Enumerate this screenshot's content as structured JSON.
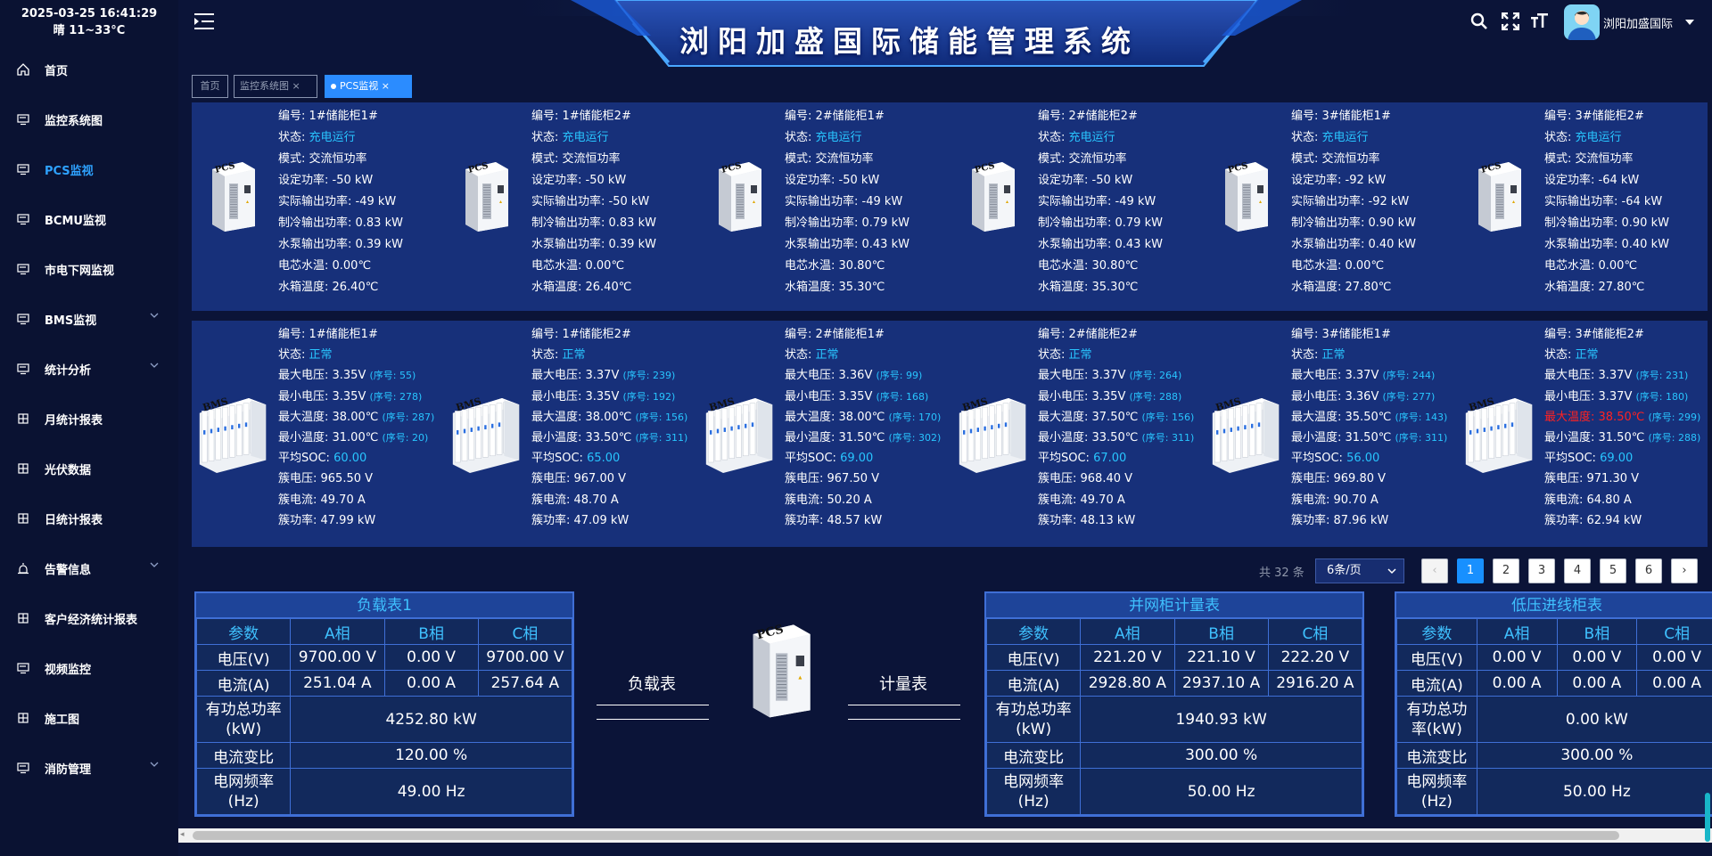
{
  "header": {
    "datetime": "2025-03-25 16:41:29",
    "weather": "晴 11~33°C",
    "title": "浏阳加盛国际储能管理系统",
    "user": "浏阳加盛国际"
  },
  "sidebar": {
    "items": [
      {
        "label": "首页",
        "icon": "home-icon"
      },
      {
        "label": "监控系统图",
        "icon": "monitor-icon"
      },
      {
        "label": "PCS监视",
        "icon": "monitor-icon",
        "active": true
      },
      {
        "label": "BCMU监视",
        "icon": "monitor-icon"
      },
      {
        "label": "市电下网监视",
        "icon": "monitor-icon"
      },
      {
        "label": "BMS监视",
        "icon": "monitor-icon",
        "expandable": true
      },
      {
        "label": "统计分析",
        "icon": "monitor-icon",
        "expandable": true
      },
      {
        "label": "月统计报表",
        "icon": "grid-icon"
      },
      {
        "label": "光伏数据",
        "icon": "grid-icon"
      },
      {
        "label": "日统计报表",
        "icon": "grid-icon"
      },
      {
        "label": "告警信息",
        "icon": "alarm-icon",
        "expandable": true
      },
      {
        "label": "客户经济统计报表",
        "icon": "grid-icon"
      },
      {
        "label": "视频监控",
        "icon": "monitor-icon"
      },
      {
        "label": "施工图",
        "icon": "grid-icon"
      },
      {
        "label": "消防管理",
        "icon": "monitor-icon",
        "expandable": true
      }
    ]
  },
  "tabs": [
    {
      "label": "首页"
    },
    {
      "label": "监控系统图",
      "close": "×"
    },
    {
      "label": "PCS监视",
      "close": "×",
      "active": true
    }
  ],
  "pcs": [
    {
      "id": "编号: 1#储能柜1#",
      "status_label": "状态: ",
      "status": "充电运行",
      "mode": "模式: 交流恒功率",
      "set_power": "设定功率: -50 kW",
      "actual_power": "实际输出功率: -49 kW",
      "cool_power": "制冷输出功率: 0.83 kW",
      "pump_power": "水泵输出功率: 0.39 kW",
      "cell_temp": "电芯水温: 0.00℃",
      "tank_temp": "水箱温度: 26.40℃"
    },
    {
      "id": "编号: 1#储能柜2#",
      "status_label": "状态: ",
      "status": "充电运行",
      "mode": "模式: 交流恒功率",
      "set_power": "设定功率: -50 kW",
      "actual_power": "实际输出功率: -50 kW",
      "cool_power": "制冷输出功率: 0.83 kW",
      "pump_power": "水泵输出功率: 0.39 kW",
      "cell_temp": "电芯水温: 0.00℃",
      "tank_temp": "水箱温度: 26.40℃"
    },
    {
      "id": "编号: 2#储能柜1#",
      "status_label": "状态: ",
      "status": "充电运行",
      "mode": "模式: 交流恒功率",
      "set_power": "设定功率: -50 kW",
      "actual_power": "实际输出功率: -49 kW",
      "cool_power": "制冷输出功率: 0.79 kW",
      "pump_power": "水泵输出功率: 0.43 kW",
      "cell_temp": "电芯水温: 30.80℃",
      "tank_temp": "水箱温度: 35.30℃"
    },
    {
      "id": "编号: 2#储能柜2#",
      "status_label": "状态: ",
      "status": "充电运行",
      "mode": "模式: 交流恒功率",
      "set_power": "设定功率: -50 kW",
      "actual_power": "实际输出功率: -49 kW",
      "cool_power": "制冷输出功率: 0.79 kW",
      "pump_power": "水泵输出功率: 0.43 kW",
      "cell_temp": "电芯水温: 30.80℃",
      "tank_temp": "水箱温度: 35.30℃"
    },
    {
      "id": "编号: 3#储能柜1#",
      "status_label": "状态: ",
      "status": "充电运行",
      "mode": "模式: 交流恒功率",
      "set_power": "设定功率: -92 kW",
      "actual_power": "实际输出功率: -92 kW",
      "cool_power": "制冷输出功率: 0.90 kW",
      "pump_power": "水泵输出功率: 0.40 kW",
      "cell_temp": "电芯水温: 0.00℃",
      "tank_temp": "水箱温度: 27.80℃"
    },
    {
      "id": "编号: 3#储能柜2#",
      "status_label": "状态: ",
      "status": "充电运行",
      "mode": "模式: 交流恒功率",
      "set_power": "设定功率: -64 kW",
      "actual_power": "实际输出功率: -64 kW",
      "cool_power": "制冷输出功率: 0.90 kW",
      "pump_power": "水泵输出功率: 0.40 kW",
      "cell_temp": "电芯水温: 0.00℃",
      "tank_temp": "水箱温度: 27.80℃"
    }
  ],
  "bms": [
    {
      "id": "编号: 1#储能柜1#",
      "status_label": "状态: ",
      "status": "正常",
      "max_v": "最大电压: 3.35V",
      "max_v_seq": "(序号: 55)",
      "min_v": "最小电压: 3.35V",
      "min_v_seq": "(序号: 278)",
      "max_t_label": "最大温度: ",
      "max_t": "38.00℃",
      "max_t_seq": "(序号: 287)",
      "min_t": "最小温度: 31.00℃",
      "min_t_seq": "(序号: 20)",
      "soc_label": "平均SOC: ",
      "soc": "60.00",
      "cluster_v": "簇电压: 965.50 V",
      "cluster_i": "簇电流: 49.70 A",
      "cluster_p": "簇功率: 47.99 kW",
      "alarm": false
    },
    {
      "id": "编号: 1#储能柜2#",
      "status_label": "状态: ",
      "status": "正常",
      "max_v": "最大电压: 3.37V",
      "max_v_seq": "(序号: 239)",
      "min_v": "最小电压: 3.35V",
      "min_v_seq": "(序号: 192)",
      "max_t_label": "最大温度: ",
      "max_t": "38.00℃",
      "max_t_seq": "(序号: 156)",
      "min_t": "最小温度: 33.50℃",
      "min_t_seq": "(序号: 311)",
      "soc_label": "平均SOC: ",
      "soc": "65.00",
      "cluster_v": "簇电压: 967.00 V",
      "cluster_i": "簇电流: 48.70 A",
      "cluster_p": "簇功率: 47.09 kW",
      "alarm": false
    },
    {
      "id": "编号: 2#储能柜1#",
      "status_label": "状态: ",
      "status": "正常",
      "max_v": "最大电压: 3.36V",
      "max_v_seq": "(序号: 99)",
      "min_v": "最小电压: 3.35V",
      "min_v_seq": "(序号: 168)",
      "max_t_label": "最大温度: ",
      "max_t": "38.00℃",
      "max_t_seq": "(序号: 170)",
      "min_t": "最小温度: 31.50℃",
      "min_t_seq": "(序号: 302)",
      "soc_label": "平均SOC: ",
      "soc": "69.00",
      "cluster_v": "簇电压: 967.50 V",
      "cluster_i": "簇电流: 50.20 A",
      "cluster_p": "簇功率: 48.57 kW",
      "alarm": false
    },
    {
      "id": "编号: 2#储能柜2#",
      "status_label": "状态: ",
      "status": "正常",
      "max_v": "最大电压: 3.37V",
      "max_v_seq": "(序号: 264)",
      "min_v": "最小电压: 3.35V",
      "min_v_seq": "(序号: 288)",
      "max_t_label": "最大温度: ",
      "max_t": "37.50℃",
      "max_t_seq": "(序号: 156)",
      "min_t": "最小温度: 33.50℃",
      "min_t_seq": "(序号: 311)",
      "soc_label": "平均SOC: ",
      "soc": "67.00",
      "cluster_v": "簇电压: 968.40 V",
      "cluster_i": "簇电流: 49.70 A",
      "cluster_p": "簇功率: 48.13 kW",
      "alarm": false
    },
    {
      "id": "编号: 3#储能柜1#",
      "status_label": "状态: ",
      "status": "正常",
      "max_v": "最大电压: 3.37V",
      "max_v_seq": "(序号: 244)",
      "min_v": "最小电压: 3.36V",
      "min_v_seq": "(序号: 277)",
      "max_t_label": "最大温度: ",
      "max_t": "35.50℃",
      "max_t_seq": "(序号: 143)",
      "min_t": "最小温度: 31.50℃",
      "min_t_seq": "(序号: 311)",
      "soc_label": "平均SOC: ",
      "soc": "56.00",
      "cluster_v": "簇电压: 969.80 V",
      "cluster_i": "簇电流: 90.70 A",
      "cluster_p": "簇功率: 87.96 kW",
      "alarm": false
    },
    {
      "id": "编号: 3#储能柜2#",
      "status_label": "状态: ",
      "status": "正常",
      "max_v": "最大电压: 3.37V",
      "max_v_seq": "(序号: 231)",
      "min_v": "最小电压: 3.37V",
      "min_v_seq": "(序号: 180)",
      "max_t_label": "最大温度: ",
      "max_t": "38.50℃",
      "max_t_seq": "(序号: 299)",
      "min_t": "最小温度: 31.50℃",
      "min_t_seq": "(序号: 288)",
      "soc_label": "平均SOC: ",
      "soc": "69.00",
      "cluster_v": "簇电压: 971.30 V",
      "cluster_i": "簇电流: 64.80 A",
      "cluster_p": "簇功率: 62.94 kW",
      "alarm": true
    }
  ],
  "pagination": {
    "total": "共 32 条",
    "page_size": "6条/页",
    "prev": "‹",
    "next": "›",
    "pages": [
      "1",
      "2",
      "3",
      "4",
      "5",
      "6"
    ],
    "current": "1"
  },
  "meters": [
    {
      "title": "负载表1",
      "headers": [
        "参数",
        "A相",
        "B相",
        "C相"
      ],
      "rows": [
        [
          "电压(V)",
          "9700.00 V",
          "0.00 V",
          "9700.00 V"
        ],
        [
          "电流(A)",
          "251.04 A",
          "0.00 A",
          "257.64 A"
        ]
      ],
      "total_power_label": "有功总功率(kW)",
      "total_power": "4252.80 kW",
      "ratio_label": "电流变比",
      "ratio": "120.00 %",
      "freq_label": "电网频率(Hz)",
      "freq": "49.00 Hz"
    },
    {
      "title": "并网柜计量表",
      "headers": [
        "参数",
        "A相",
        "B相",
        "C相"
      ],
      "rows": [
        [
          "电压(V)",
          "221.20 V",
          "221.10 V",
          "222.20 V"
        ],
        [
          "电流(A)",
          "2928.80 A",
          "2937.10 A",
          "2916.20 A"
        ]
      ],
      "total_power_label": "有功总功率(kW)",
      "total_power": "1940.93 kW",
      "ratio_label": "电流变比",
      "ratio": "300.00 %",
      "freq_label": "电网频率(Hz)",
      "freq": "50.00 Hz"
    },
    {
      "title": "低压进线柜表",
      "headers": [
        "参数",
        "A相",
        "B相",
        "C相"
      ],
      "rows": [
        [
          "电压(V)",
          "0.00 V",
          "0.00 V",
          "0.00 V"
        ],
        [
          "电流(A)",
          "0.00 A",
          "0.00 A",
          "0.00 A"
        ]
      ],
      "total_power_label": "有功总功率(kW)",
      "total_power": "0.00 kW",
      "ratio_label": "电流变比",
      "ratio": "300.00 %",
      "freq_label": "电网频率(Hz)",
      "freq": "50.00 Hz"
    }
  ],
  "middle": {
    "left_label": "负载表",
    "right_label": "计量表",
    "device_label": "PCS"
  },
  "device_labels": {
    "pcs": "PCS",
    "bms": "BMS"
  },
  "colors": {
    "accent": "#2b8cff",
    "status_blue": "#28c5ff",
    "alarm": "#ff2222",
    "panel": "#17307a"
  }
}
